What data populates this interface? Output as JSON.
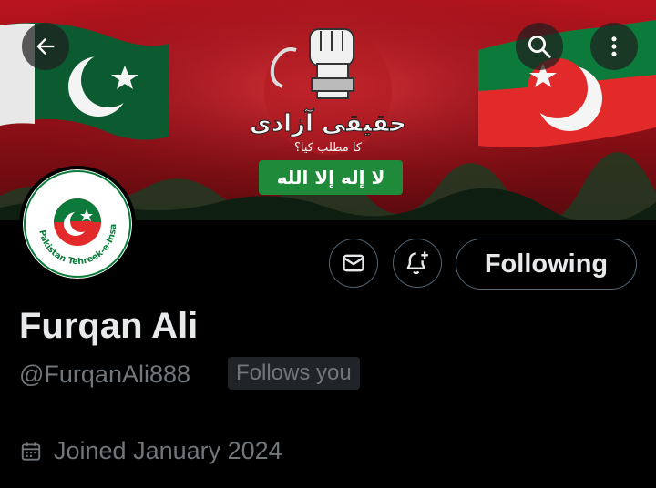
{
  "banner": {
    "urdu_slogan": "حقیقی آزادی",
    "urdu_subtitle": "کا مطلب کیا؟",
    "kalima": "لا إله إلا الله"
  },
  "avatar": {
    "ring_text": "Pakistan Tehreek-e-Insaf",
    "ring_urdu": "پاکستان تحریک انصاف"
  },
  "actions": {
    "following_label": "Following"
  },
  "profile": {
    "name": "Furqan Ali",
    "handle": "@FurqanAli888",
    "follows_badge": "Follows you",
    "joined": "Joined January 2024"
  },
  "colors": {
    "background": "#000000",
    "text_primary": "#e7e9ea",
    "text_secondary": "#71767b",
    "border": "#536471",
    "pti_green": "#0d7a3a",
    "pti_red": "#e32a2a"
  },
  "icons": [
    "back-arrow-icon",
    "search-icon",
    "more-vertical-icon",
    "mail-icon",
    "notification-add-icon",
    "calendar-icon"
  ]
}
